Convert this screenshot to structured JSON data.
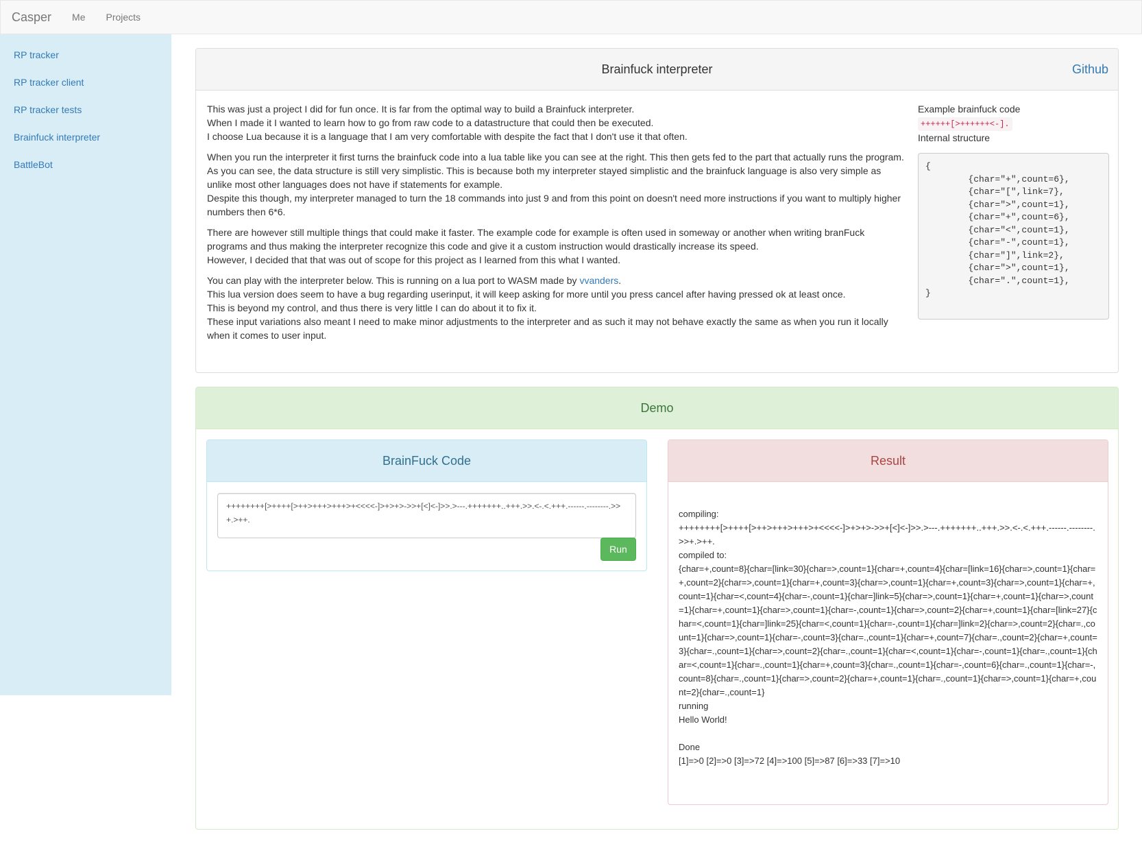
{
  "navbar": {
    "brand": "Casper",
    "links": [
      "Me",
      "Projects"
    ]
  },
  "sidebar": {
    "items": [
      "RP tracker",
      "RP tracker client",
      "RP tracker tests",
      "Brainfuck interpreter",
      "BattleBot"
    ]
  },
  "project": {
    "title": "Brainfuck interpreter",
    "github_label": "Github",
    "paragraphs": [
      [
        "This was just a project I did for fun once. It is far from the optimal way to build a Brainfuck interpreter.",
        "When I made it I wanted to learn how to go from raw code to a datastructure that could then be executed.",
        "I choose Lua because it is a language that I am very comfortable with despite the fact that I don't use it that often."
      ],
      [
        "When you run the interpreter it first turns the brainfuck code into a lua table like you can see at the right. This then gets fed to the part that actually runs the program.",
        "As you can see, the data structure is still very simplistic. This is because both my interpreter stayed simplistic and the brainfuck language is also very simple as unlike most other languages does not have if statements for example.",
        "Despite this though, my interpreter managed to turn the 18 commands into just 9 and from this point on doesn't need more instructions if you want to multiply higher numbers then 6*6."
      ],
      [
        "There are however still multiple things that could make it faster. The example code for example is often used in someway or another when writing branFuck programs and thus making the interpreter recognize this code and give it a custom instruction would drastically increase its speed.",
        "However, I decided that that was out of scope for this project as I learned from this what I wanted."
      ]
    ],
    "last_paragraph": {
      "intro": "You can play with the interpreter below. This is running on a lua port to WASM made by ",
      "link": "vvanders",
      "intro_end": ".",
      "lines": [
        "This lua version does seem to have a bug regarding userinput, it will keep asking for more until you press cancel after having pressed ok at least once.",
        "This is beyond my control, and thus there is very little I can do about it to fix it.",
        "These input variations also meant I need to make minor adjustments to the interpreter and as such it may not behave exactly the same as when you run it locally when it comes to user input."
      ]
    },
    "example": {
      "label": "Example brainfuck code",
      "code": "++++++[>++++++<-].",
      "structure_label": "Internal structure",
      "structure": "{\n        {char=\"+\",count=6},\n        {char=\"[\",link=7},\n        {char=\">\",count=1},\n        {char=\"+\",count=6},\n        {char=\"<\",count=1},\n        {char=\"-\",count=1},\n        {char=\"]\",link=2},\n        {char=\">\",count=1},\n        {char=\".\",count=1},\n}"
    }
  },
  "demo": {
    "title": "Demo",
    "code_panel_title": "BrainFuck Code",
    "code_value": "++++++++[>++++[>++>+++>+++>+<<<<-]>+>+>->>+[<]<-]>>.>---.+++++++..+++.>>.<-.<.+++.------.--------.>>+.>++.",
    "run_label": "Run",
    "result_panel_title": "Result",
    "result_lines": [
      "compiling:",
      "++++++++[>++++[>++>+++>+++>+<<<<-]>+>+>->>+[<]<-]>>.>---.+++++++..+++.>>.<-.<.+++.------.--------.>>+.>++.",
      "compiled to:",
      "{char=+,count=8}{char=[link=30}{char=>,count=1}{char=+,count=4}{char=[link=16}{char=>,count=1}{char=+,count=2}{char=>,count=1}{char=+,count=3}{char=>,count=1}{char=+,count=3}{char=>,count=1}{char=+,count=1}{char=<,count=4}{char=-,count=1}{char=]link=5}{char=>,count=1}{char=+,count=1}{char=>,count=1}{char=+,count=1}{char=>,count=1}{char=-,count=1}{char=>,count=2}{char=+,count=1}{char=[link=27}{char=<,count=1}{char=]link=25}{char=<,count=1}{char=-,count=1}{char=]link=2}{char=>,count=2}{char=.,count=1}{char=>,count=1}{char=-,count=3}{char=.,count=1}{char=+,count=7}{char=.,count=2}{char=+,count=3}{char=.,count=1}{char=>,count=2}{char=.,count=1}{char=<,count=1}{char=-,count=1}{char=.,count=1}{char=<,count=1}{char=.,count=1}{char=+,count=3}{char=.,count=1}{char=-,count=6}{char=.,count=1}{char=-,count=8}{char=.,count=1}{char=>,count=2}{char=+,count=1}{char=.,count=1}{char=>,count=1}{char=+,count=2}{char=.,count=1}",
      "running",
      "Hello World!",
      "",
      "Done",
      "[1]=>0 [2]=>0 [3]=>72 [4]=>100 [5]=>87 [6]=>33 [7]=>10"
    ]
  }
}
